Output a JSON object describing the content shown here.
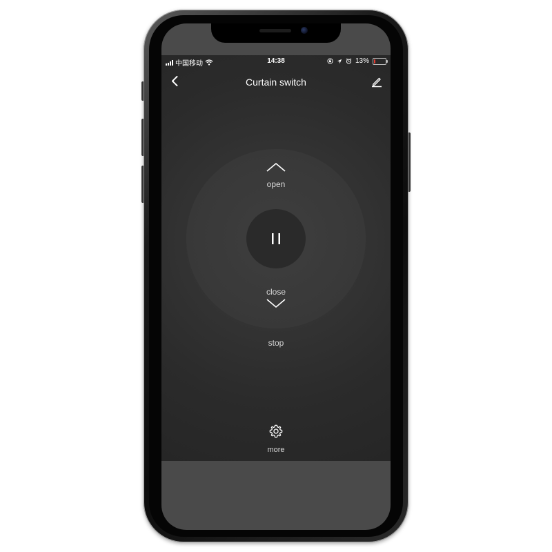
{
  "status_bar": {
    "carrier": "中国移动",
    "time": "14:38",
    "battery_percent": "13%",
    "battery_level": 0.13,
    "battery_color": "#e83a2f"
  },
  "nav": {
    "title": "Curtain switch",
    "back_icon": "chevron-left-icon",
    "edit_icon": "pencil-icon"
  },
  "controls": {
    "open_label": "open",
    "close_label": "close",
    "stop_label": "stop",
    "more_label": "more",
    "pause_icon": "pause-icon",
    "more_icon": "gear-icon"
  },
  "colors": {
    "app_background": "#2b2b2b",
    "dial": "#3a3a3a",
    "pause_button": "#2a2a2a",
    "text": "#d8d8d8"
  }
}
